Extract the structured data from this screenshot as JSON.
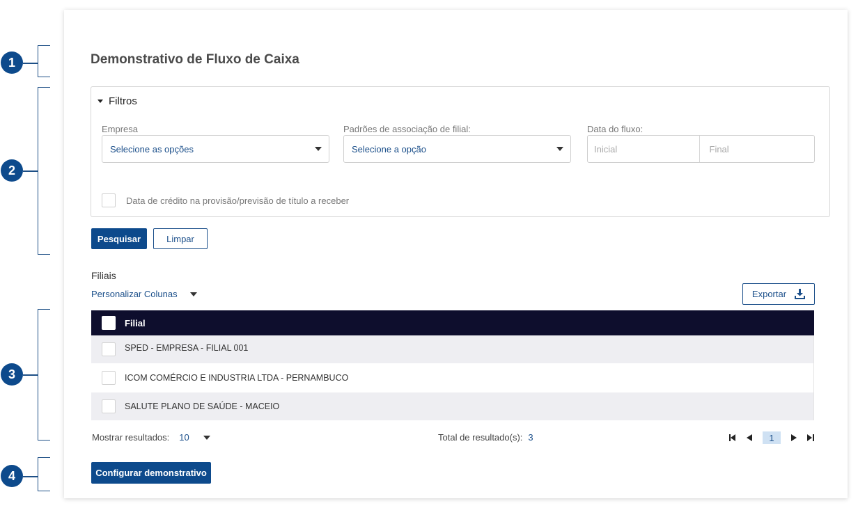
{
  "callouts": [
    "1",
    "2",
    "3",
    "4"
  ],
  "page": {
    "title": "Demonstrativo de Fluxo de Caixa"
  },
  "filters": {
    "header": "Filtros",
    "empresa": {
      "label": "Empresa",
      "value": "Selecione as opções"
    },
    "padroes": {
      "label": "Padrões de associação de filial:",
      "value": "Selecione a opção"
    },
    "data_fluxo": {
      "label": "Data do fluxo:",
      "start_placeholder": "Inicial",
      "end_placeholder": "Final"
    },
    "checkbox_label": "Data de crédito na provisão/previsão de título a receber"
  },
  "actions": {
    "search": "Pesquisar",
    "clear": "Limpar",
    "configure": "Configurar demonstrativo"
  },
  "grid": {
    "section_label": "Filiais",
    "customize_columns": "Personalizar Colunas",
    "export": "Exportar",
    "column_header": "Filial",
    "rows": [
      "SPED - EMPRESA - FILIAL 001",
      "ICOM COMÉRCIO E INDUSTRIA LTDA - PERNAMBUCO",
      "SALUTE PLANO DE SAÚDE - MACEIO"
    ],
    "show_results_label": "Mostrar resultados:",
    "page_size": "10",
    "total_label": "Total de resultado(s):",
    "total_count": "3",
    "current_page": "1"
  },
  "colors": {
    "primary": "#0d4a8c",
    "table_header": "#0e0e2d",
    "link": "#1b4f8a"
  }
}
